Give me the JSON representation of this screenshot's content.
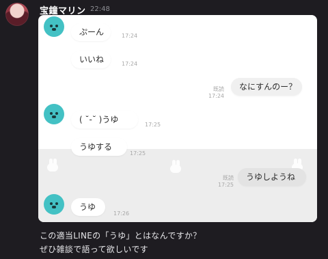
{
  "header": {
    "author": "宝鐘マリン",
    "timestamp": "22:48"
  },
  "chat": {
    "messages": [
      {
        "side": "left",
        "text": "ぷーん",
        "time": "17:24"
      },
      {
        "side": "left",
        "text": "いいね",
        "time": "17:24"
      },
      {
        "side": "right",
        "text": "なにすんのー？",
        "read": "既読",
        "time": "17:24"
      },
      {
        "side": "left",
        "text": "( ˘-˘ )うゆ",
        "time": "17:25"
      },
      {
        "side": "left",
        "text": "うゆする",
        "time": "17:25"
      },
      {
        "side": "right",
        "text": "うゆしようね",
        "read": "既読",
        "time": "17:25"
      },
      {
        "side": "left",
        "text": "うゆ",
        "time": "17:26"
      }
    ]
  },
  "caption": {
    "line1": "この適当LINEの「うゆ」とはなんですか？",
    "line2": "ぜひ雑談で語って欲しいです"
  },
  "colors": {
    "background": "#1e1c21",
    "bear_icon": "#43c1c4"
  }
}
